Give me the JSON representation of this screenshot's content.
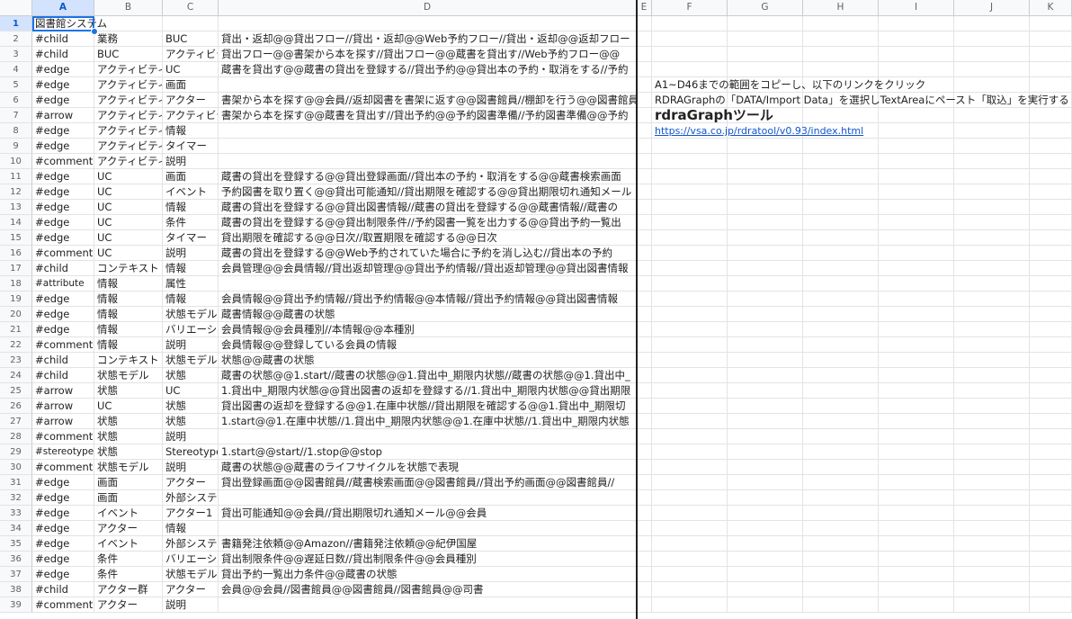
{
  "columns": [
    "A",
    "B",
    "C",
    "D",
    "E",
    "F",
    "G",
    "H",
    "I",
    "J",
    "K"
  ],
  "selected_column": "A",
  "selected_row": "1",
  "rows": [
    {
      "n": "1",
      "a": "図書館システム",
      "b": "",
      "c": "",
      "d": ""
    },
    {
      "n": "2",
      "a": "#child",
      "b": "業務",
      "c": "BUC",
      "d": "貸出・返却@@貸出フロー//貸出・返却@@Web予約フロー//貸出・返却@@返却フロー"
    },
    {
      "n": "3",
      "a": "#child",
      "b": "BUC",
      "c": "アクティビティ",
      "d": "貸出フロー@@書架から本を探す//貸出フロー@@蔵書を貸出す//Web予約フロー@@"
    },
    {
      "n": "4",
      "a": "#edge",
      "b": "アクティビティ",
      "c": "UC",
      "d": "蔵書を貸出す@@蔵書の貸出を登録する//貸出予約@@貸出本の予約・取消をする//予約"
    },
    {
      "n": "5",
      "a": "#edge",
      "b": "アクティビティ",
      "c": "画面",
      "d": ""
    },
    {
      "n": "6",
      "a": "#edge",
      "b": "アクティビティ",
      "c": "アクター",
      "d": "書架から本を探す@@会員//返却図書を書架に返す@@図書館員//棚卸を行う@@図書館員"
    },
    {
      "n": "7",
      "a": "#arrow",
      "b": "アクティビティ",
      "c": "アクティビティ",
      "d": "書架から本を探す@@蔵書を貸出す//貸出予約@@予約図書準備//予約図書準備@@予約"
    },
    {
      "n": "8",
      "a": "#edge",
      "b": "アクティビティ",
      "c": "情報",
      "d": ""
    },
    {
      "n": "9",
      "a": "#edge",
      "b": "アクティビティ",
      "c": "タイマー",
      "d": ""
    },
    {
      "n": "10",
      "a": "#comment",
      "b": "アクティビティ",
      "c": "説明",
      "d": ""
    },
    {
      "n": "11",
      "a": "#edge",
      "b": "UC",
      "c": "画面",
      "d": "蔵書の貸出を登録する@@貸出登録画面//貸出本の予約・取消をする@@蔵書検索画面"
    },
    {
      "n": "12",
      "a": "#edge",
      "b": "UC",
      "c": "イベント",
      "d": "予約図書を取り置く@@貸出可能通知//貸出期限を確認する@@貸出期限切れ通知メール"
    },
    {
      "n": "13",
      "a": "#edge",
      "b": "UC",
      "c": "情報",
      "d": "蔵書の貸出を登録する@@貸出図書情報//蔵書の貸出を登録する@@蔵書情報//蔵書の"
    },
    {
      "n": "14",
      "a": "#edge",
      "b": "UC",
      "c": "条件",
      "d": "蔵書の貸出を登録する@@貸出制限条件//予約図書一覧を出力する@@貸出予約一覧出"
    },
    {
      "n": "15",
      "a": "#edge",
      "b": "UC",
      "c": "タイマー",
      "d": "貸出期限を確認する@@日次//取置期限を確認する@@日次"
    },
    {
      "n": "16",
      "a": "#comment",
      "b": "UC",
      "c": "説明",
      "d": "蔵書の貸出を登録する@@Web予約されていた場合に予約を消し込む//貸出本の予約"
    },
    {
      "n": "17",
      "a": "#child",
      "b": "コンテキスト",
      "c": "情報",
      "d": "会員管理@@会員情報//貸出返却管理@@貸出予約情報//貸出返却管理@@貸出図書情報"
    },
    {
      "n": "18",
      "a": "#attribute",
      "b": "情報",
      "c": "属性",
      "d": ""
    },
    {
      "n": "19",
      "a": "#edge",
      "b": "情報",
      "c": "情報",
      "d": "会員情報@@貸出予約情報//貸出予約情報@@本情報//貸出予約情報@@貸出図書情報"
    },
    {
      "n": "20",
      "a": "#edge",
      "b": "情報",
      "c": "状態モデル",
      "d": "蔵書情報@@蔵書の状態"
    },
    {
      "n": "21",
      "a": "#edge",
      "b": "情報",
      "c": "バリエーション",
      "d": "会員情報@@会員種別//本情報@@本種別"
    },
    {
      "n": "22",
      "a": "#comment",
      "b": "情報",
      "c": "説明",
      "d": "会員情報@@登録している会員の情報"
    },
    {
      "n": "23",
      "a": "#child",
      "b": "コンテキスト",
      "c": "状態モデル",
      "d": "状態@@蔵書の状態"
    },
    {
      "n": "24",
      "a": "#child",
      "b": "状態モデル",
      "c": "状態",
      "d": "蔵書の状態@@1.start//蔵書の状態@@1.貸出中_期限内状態//蔵書の状態@@1.貸出中_"
    },
    {
      "n": "25",
      "a": "#arrow",
      "b": "状態",
      "c": "UC",
      "d": "1.貸出中_期限内状態@@貸出図書の返却を登録する//1.貸出中_期限内状態@@貸出期限"
    },
    {
      "n": "26",
      "a": "#arrow",
      "b": "UC",
      "c": "状態",
      "d": "貸出図書の返却を登録する@@1.在庫中状態//貸出期限を確認する@@1.貸出中_期限切"
    },
    {
      "n": "27",
      "a": "#arrow",
      "b": "状態",
      "c": "状態",
      "d": "1.start@@1.在庫中状態//1.貸出中_期限内状態@@1.在庫中状態//1.貸出中_期限内状態"
    },
    {
      "n": "28",
      "a": "#comment",
      "b": "状態",
      "c": "説明",
      "d": ""
    },
    {
      "n": "29",
      "a": "#stereotype",
      "b": "状態",
      "c": "Stereotype",
      "d": "1.start@@start//1.stop@@stop"
    },
    {
      "n": "30",
      "a": "#comment",
      "b": "状態モデル",
      "c": "説明",
      "d": "蔵書の状態@@蔵書のライフサイクルを状態で表現"
    },
    {
      "n": "31",
      "a": "#edge",
      "b": "画面",
      "c": "アクター",
      "d": "貸出登録画面@@図書館員//蔵書検索画面@@図書館員//貸出予約画面@@図書館員//"
    },
    {
      "n": "32",
      "a": "#edge",
      "b": "画面",
      "c": "外部システム",
      "d": ""
    },
    {
      "n": "33",
      "a": "#edge",
      "b": "イベント",
      "c": "アクター1",
      "d": "貸出可能通知@@会員//貸出期限切れ通知メール@@会員"
    },
    {
      "n": "34",
      "a": "#edge",
      "b": "アクター",
      "c": "情報",
      "d": ""
    },
    {
      "n": "35",
      "a": "#edge",
      "b": "イベント",
      "c": "外部システム",
      "d": "書籍発注依頼@@Amazon//書籍発注依頼@@紀伊国屋"
    },
    {
      "n": "36",
      "a": "#edge",
      "b": "条件",
      "c": "バリエーション",
      "d": "貸出制限条件@@遅延日数//貸出制限条件@@会員種別"
    },
    {
      "n": "37",
      "a": "#edge",
      "b": "条件",
      "c": "状態モデル",
      "d": "貸出予約一覧出力条件@@蔵書の状態"
    },
    {
      "n": "38",
      "a": "#child",
      "b": "アクター群",
      "c": "アクター",
      "d": "会員@@会員//図書館員@@図書館員//図書館員@@司書"
    },
    {
      "n": "39",
      "a": "#comment",
      "b": "アクター",
      "c": "説明",
      "d": ""
    }
  ],
  "notes": {
    "instruction1": "A1~D46までの範囲をコピーし、以下のリンクをクリック",
    "instruction2": "RDRAGraphの「DATA/Import Data」を選択しTextAreaにペースト「取込」を実行する",
    "tool_title": "rdraGraphツール",
    "tool_link": "https://vsa.co.jp/rdratool/v0.93/index.html"
  }
}
